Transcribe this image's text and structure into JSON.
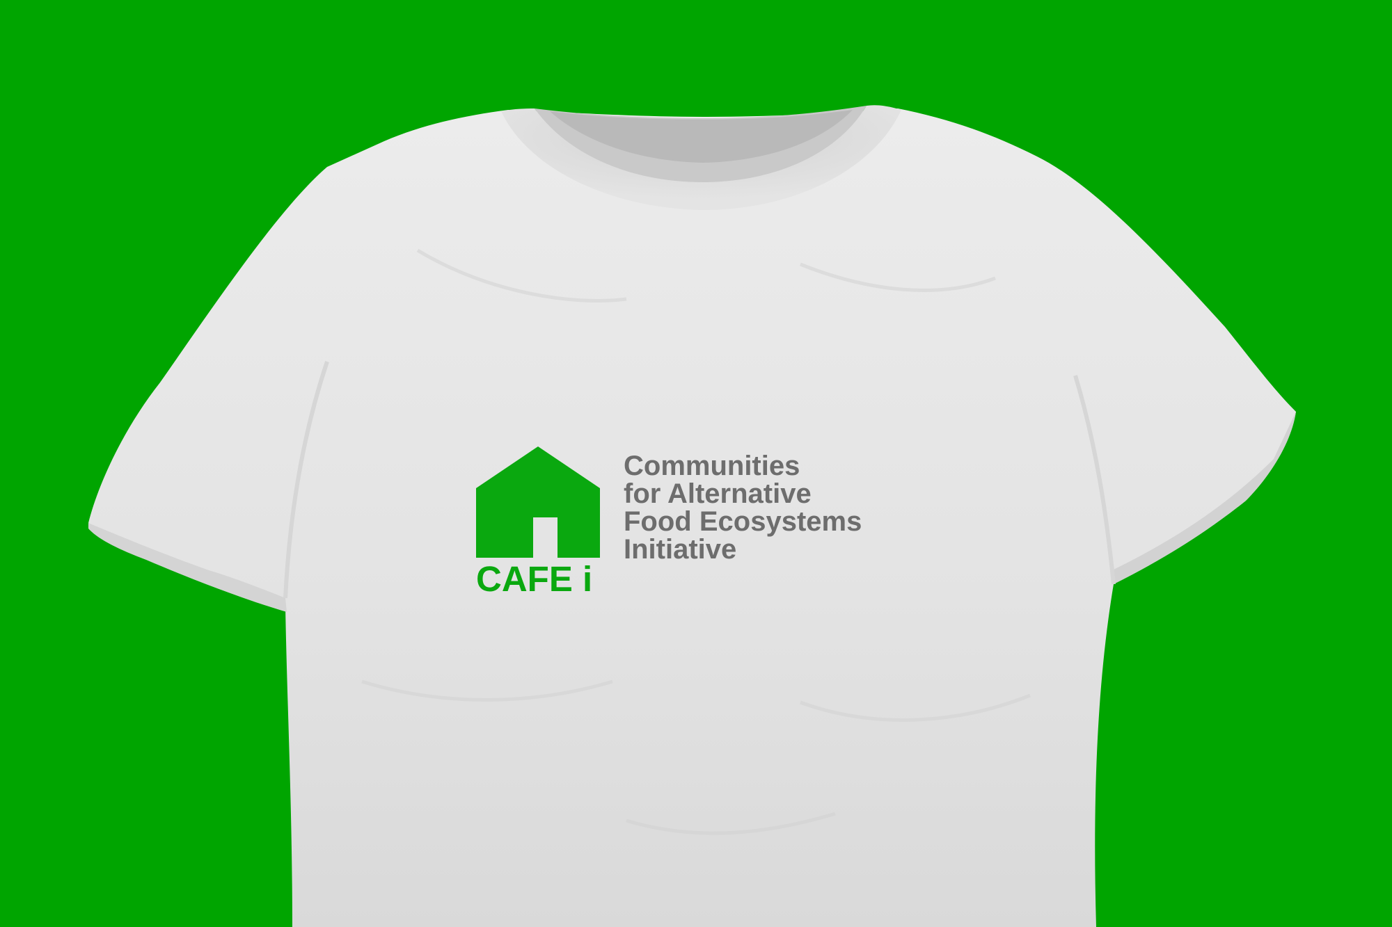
{
  "scene": {
    "background_color": "#00a500",
    "shirt_color": "#e6e6e6",
    "shirt_shadow_color": "#cfcfcf"
  },
  "logo": {
    "mark_icon": "house-icon",
    "mark_color": "#0aa80f",
    "wordmark": "CAFE i",
    "tagline_color": "#6d6d6d",
    "tagline_lines": [
      "Communities",
      "for Alternative",
      "Food Ecosystems",
      "Initiative"
    ]
  }
}
